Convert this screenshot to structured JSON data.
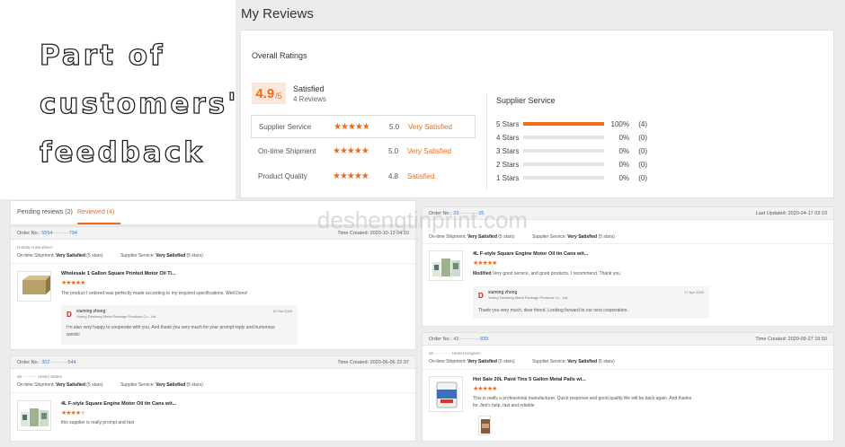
{
  "hero": {
    "lines": [
      "Part of",
      "customers'",
      "feedback"
    ]
  },
  "page_title": "My Reviews",
  "overall": {
    "title": "Overall Ratings",
    "score": "4.9",
    "score_max": "/5",
    "satisfaction": "Satisfied",
    "review_count": "4 Reviews",
    "dimensions": [
      {
        "name": "Supplier Service",
        "stars": "★★★★★",
        "value": "5.0",
        "text": "Very Satisfied"
      },
      {
        "name": "On-time Shipment",
        "stars": "★★★★★",
        "value": "5.0",
        "text": "Very Satisfied"
      },
      {
        "name": "Product Quality",
        "stars": "★★★★★",
        "value": "4.8",
        "text": "Satisfied"
      }
    ]
  },
  "supplier_service": {
    "title": "Supplier Service",
    "rows": [
      {
        "label": "5 Stars",
        "pct": "100%",
        "count": "(4)",
        "fraction": 1.0
      },
      {
        "label": "4 Stars",
        "pct": "0%",
        "count": "(0)",
        "fraction": 0
      },
      {
        "label": "3 Stars",
        "pct": "0%",
        "count": "(0)",
        "fraction": 0
      },
      {
        "label": "2 Stars",
        "pct": "0%",
        "count": "(0)",
        "fraction": 0
      },
      {
        "label": "1 Stars",
        "pct": "0%",
        "count": "(0)",
        "fraction": 0
      }
    ]
  },
  "tabs": [
    {
      "label": "Pending reviews (2)"
    },
    {
      "label": "Reviewed (4)"
    }
  ],
  "watermark": "deshengtinprint.com",
  "orders": [
    {
      "order_no_label": "Order No.:",
      "order_no": "5554··········794",
      "time": "Time Created: 2020-10-13 04:10",
      "buyer": "Hobalu Antwrufasel",
      "shipment": "On-time Shipment: ",
      "shipment_val": "Very Satisfied",
      "shipment_stars": "(5 stars)",
      "service": "Supplier Service: ",
      "service_val": "Very Satisfied",
      "service_stars": "(5 stars)",
      "product": "Wholesale 1 Gallon Square Printed Motor Oil Ti...",
      "stars": "★★★★★",
      "stars_off": "",
      "comment": "The product I ordered was perfectly made according to my required specifications. Well Done!",
      "reply_name": "xiuming zhong",
      "reply_company": "Yiwing Desheng Metal Package Products Co., Ltd.",
      "reply_date": "19 Oct 2020",
      "reply_text": "I'm also very happy to cooperate with you. And thank you very much for your prompt reply and humorous words!"
    },
    {
      "order_no_label": "Order No.:",
      "order_no": "23············35",
      "time": "Last Updated: 2020-04-17 03:10",
      "shipment": "On-time Shipment: ",
      "shipment_val": "Very Satisfied",
      "shipment_stars": "(5 stars)",
      "service": "Supplier Service: ",
      "service_val": "Very Satisfied",
      "service_stars": "(5 stars)",
      "product": "4L F-style Square Engine Motor Oil tin Cans wit...",
      "stars": "★★★★★",
      "stars_off": "",
      "comment_prefix": "Modified",
      "comment": "Very good service, and good products. I recommend. Thank you",
      "reply_name": "xiuming zhong",
      "reply_company": "Yiwing Desheng Metal Package Products Co., Ltd.",
      "reply_date": "17 Apr 2020",
      "reply_text": "Thank you very much, dear friend. Looking forward to our next cooperation."
    },
    {
      "order_no_label": "Order No.:",
      "order_no": "302···········544",
      "time": "Time Created: 2020-06-06 22:37",
      "buyer": "ab··········· United States",
      "shipment": "On-time Shipment: ",
      "shipment_val": "Very Satisfied",
      "shipment_stars": "(5 stars)",
      "service": "Supplier Service: ",
      "service_val": "Very Satisfied",
      "service_stars": "(5 stars)",
      "product": "4L F-style Square Engine Motor Oil tin Cans wit...",
      "stars": "★★★★",
      "stars_off": "★",
      "comment": "this supplier is really prompt and fast"
    },
    {
      "order_no_label": "Order No.:",
      "order_no": "42·············839",
      "time": "Time Created: 2020-09-27 19:50",
      "buyer": "ah············· United Kingdom",
      "shipment": "On-time Shipment: ",
      "shipment_val": "Very Satisfied",
      "shipment_stars": "(5 stars)",
      "service": "Supplier Service: ",
      "service_val": "Very Satisfied",
      "service_stars": "(5 stars)",
      "product": "Hot Sale 20L Paint Tins 5 Gallon Metal Pails wi...",
      "stars": "★★★★★",
      "stars_off": "",
      "comment": "This is really a professional manufacturer. Quick response and good quality.We will be back again. And thanks for Jimi's help, fast and reliable"
    }
  ]
}
